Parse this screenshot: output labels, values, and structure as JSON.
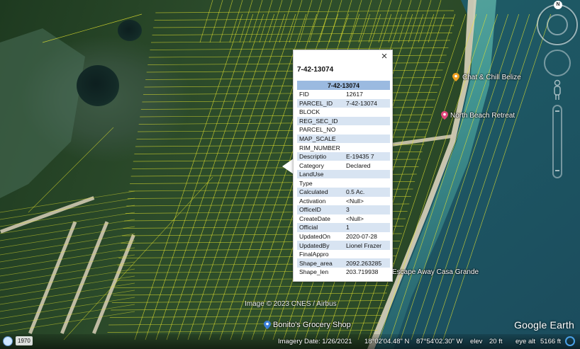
{
  "popup": {
    "title": "7-42-13074",
    "table_header": "7-42-13074",
    "close_glyph": "×",
    "rows": [
      {
        "key": "FID",
        "value": "12617"
      },
      {
        "key": "PARCEL_ID",
        "value": "7-42-13074"
      },
      {
        "key": "BLOCK",
        "value": ""
      },
      {
        "key": "REG_SEC_ID",
        "value": ""
      },
      {
        "key": "PARCEL_NO",
        "value": ""
      },
      {
        "key": "MAP_SCALE",
        "value": ""
      },
      {
        "key": "RIM_NUMBER",
        "value": ""
      },
      {
        "key": "Descriptio",
        "value": "E-19435 7"
      },
      {
        "key": "Category",
        "value": "Declared"
      },
      {
        "key": "LandUse",
        "value": ""
      },
      {
        "key": "Type",
        "value": ""
      },
      {
        "key": "Calculated",
        "value": "0.5 Ac."
      },
      {
        "key": "Activation",
        "value": "<Null>"
      },
      {
        "key": "OfficeID",
        "value": "3"
      },
      {
        "key": "CreateDate",
        "value": "<Null>"
      },
      {
        "key": "Official",
        "value": "1"
      },
      {
        "key": "UpdatedOn",
        "value": "2020-07-28"
      },
      {
        "key": "UpdatedBy",
        "value": "Lionel Frazer"
      },
      {
        "key": "FinalAppro",
        "value": ""
      },
      {
        "key": "Shape_area",
        "value": "2092.263285"
      },
      {
        "key": "Shape_len",
        "value": "203.719938"
      }
    ]
  },
  "places": {
    "chat_chill": "Chat & Chill Belize",
    "north_beach": "North Beach Retreat",
    "escape_away": "Escape Away Casa Grande",
    "bonitos": "Bonito's Grocery Shop"
  },
  "colors": {
    "parcel_lines": "#e6e62e",
    "pin_orange": "#f0a020",
    "pin_pink": "#e0457b",
    "pin_blue": "#3b7fd9",
    "popup_header": "#9bbae0",
    "popup_stripe": "#d8e4f2"
  },
  "map": {
    "copyright": "Image © 2023 CNES / Airbus",
    "brand": "Google Earth",
    "compass_letter": "N"
  },
  "status": {
    "year": "1970",
    "imagery_date": "Imagery Date: 1/26/2021",
    "lat": "18°02'04.48\" N",
    "lon": "87°54'02.30\" W",
    "elev_label": "elev",
    "elev_value": "20 ft",
    "eye_alt_label": "eye alt",
    "eye_alt_value": "5166 ft"
  }
}
